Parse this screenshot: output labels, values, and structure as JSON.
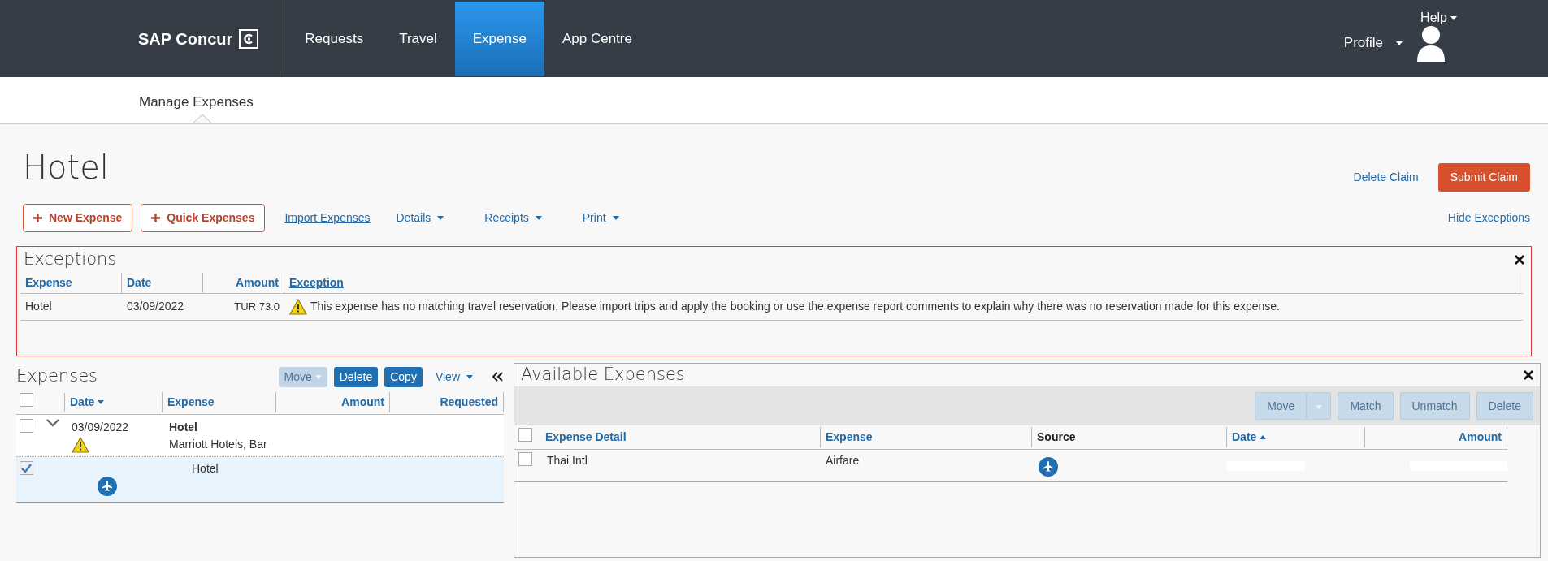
{
  "brand": "SAP Concur",
  "nav": [
    {
      "label": "Requests",
      "selected": false
    },
    {
      "label": "Travel",
      "selected": false
    },
    {
      "label": "Expense",
      "selected": true
    },
    {
      "label": "App Centre",
      "selected": false
    }
  ],
  "help": "Help",
  "profile": "Profile",
  "subnav": [
    {
      "label": "Manage Expenses",
      "selected": true
    }
  ],
  "title": "Hotel",
  "delete_claim": "Delete Claim",
  "submit_claim": "Submit Claim",
  "toolbar": [
    {
      "kind": "add",
      "label": "New Expense"
    },
    {
      "kind": "add",
      "label": "Quick Expenses"
    },
    {
      "kind": "link",
      "label": "Import Expenses"
    },
    {
      "kind": "menu",
      "label": "Details"
    },
    {
      "kind": "menu",
      "label": "Receipts"
    },
    {
      "kind": "menu",
      "label": "Print"
    }
  ],
  "hide_exceptions": "Hide Exceptions",
  "exceptions": {
    "title": "Exceptions",
    "columns": [
      "Expense",
      "Date",
      "Amount",
      "Exception"
    ],
    "rows": [
      {
        "expense": "Hotel",
        "date": "03/09/2022",
        "amount": "TUR 73.0",
        "exception": "This expense has no matching travel reservation. Please import trips and apply the booking or use the expense report comments to explain why there was no reservation made for this expense."
      }
    ]
  },
  "expenses": {
    "title": "Expenses",
    "select_all_checked": false,
    "buttons": [
      {
        "label": "Move",
        "disabled": true,
        "caret": true
      },
      {
        "label": "Delete",
        "disabled": false,
        "caret": false
      },
      {
        "label": "Copy",
        "disabled": false,
        "caret": false
      }
    ],
    "view": "View",
    "columns": [
      "Date",
      "Expense",
      "Amount",
      "Requested"
    ],
    "rows": [
      {
        "kind": "parent",
        "checked": false,
        "expanded": true,
        "date": "03/09/2022",
        "expense": "Hotel",
        "vendor": "Marriott Hotels, Bar",
        "warning": true,
        "selected": false
      },
      {
        "kind": "child",
        "checked": true,
        "expense": "Hotel",
        "warning": false,
        "selected": true
      }
    ]
  },
  "available": {
    "title": "Available Expenses",
    "select_all_checked": false,
    "buttons": [
      {
        "label": "Move",
        "disabled": true
      },
      {
        "label": "Match",
        "disabled": true
      },
      {
        "label": "Unmatch",
        "disabled": true
      },
      {
        "label": "Delete",
        "disabled": true
      }
    ],
    "columns": [
      "Expense Detail",
      "Expense",
      "Source",
      "Date",
      "Amount"
    ],
    "rows": [
      {
        "checked": false,
        "detail": "Thai Intl",
        "expense": "Airfare"
      }
    ]
  }
}
